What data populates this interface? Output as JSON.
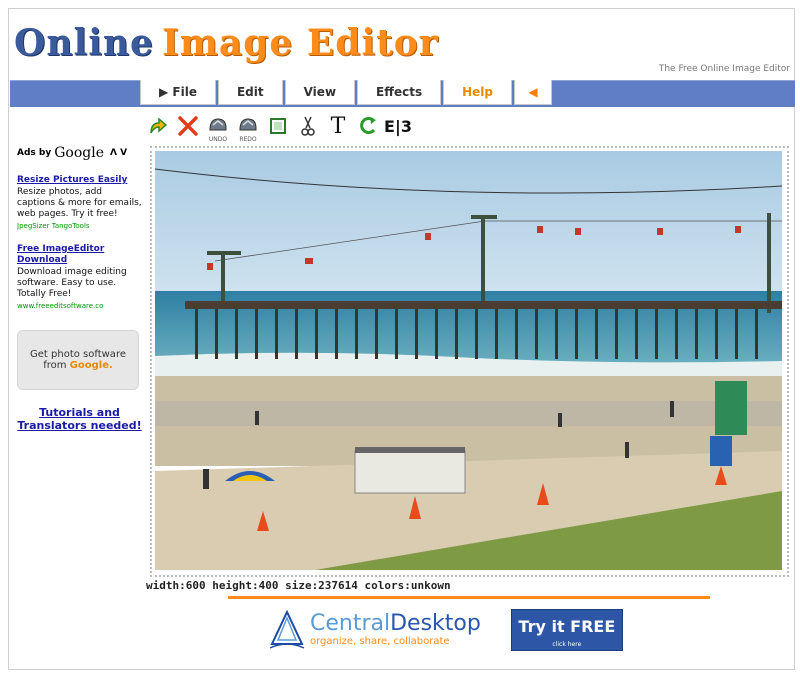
{
  "header": {
    "logo_word1": "Online",
    "logo_word2": "Image Editor",
    "tagline": "The Free Online Image Editor"
  },
  "menu": {
    "items": [
      "▶ File",
      "Edit",
      "View",
      "Effects",
      "Help"
    ],
    "collapse_glyph": "◀"
  },
  "toolbar": {
    "tools": [
      {
        "name": "upload-icon"
      },
      {
        "name": "delete-icon"
      },
      {
        "name": "undo-icon",
        "caption": "UNDO"
      },
      {
        "name": "redo-icon",
        "caption": "REDO"
      },
      {
        "name": "crop-icon"
      },
      {
        "name": "cut-icon"
      },
      {
        "name": "text-icon",
        "glyph": "T"
      },
      {
        "name": "rotate-icon",
        "glyph": "C"
      },
      {
        "name": "flip-icon",
        "glyph": "E|3"
      }
    ]
  },
  "sidebar": {
    "ads_by": "Ads by",
    "google": "Google",
    "nav_arrows": "Λ V",
    "ads": [
      {
        "title": "Resize Pictures Easily",
        "desc": "Resize photos, add captions & more for emails, web pages. Try it free!",
        "url": "JpegSizer TangoTools"
      },
      {
        "title": "Free ImageEditor Download",
        "desc": "Download image editing software. Easy to use. Totally Free!",
        "url": "www.freeeditsoftware.co"
      }
    ],
    "promo_line1": "Get photo software",
    "promo_from": "from",
    "promo_google": "Google.",
    "tutorial": "Tutorials and Translators needed!"
  },
  "image_info": "width:600 height:400 size:237614 colors:unkown",
  "banner": {
    "brand1": "Central",
    "brand2": "Desktop",
    "tagline": "organize, share, collaborate",
    "cta": "Try it FREE",
    "cta_sub": "click here"
  },
  "colors": {
    "nav": "#5f7ec3",
    "accent": "#ff8c1a",
    "link": "#1a1aa6"
  }
}
